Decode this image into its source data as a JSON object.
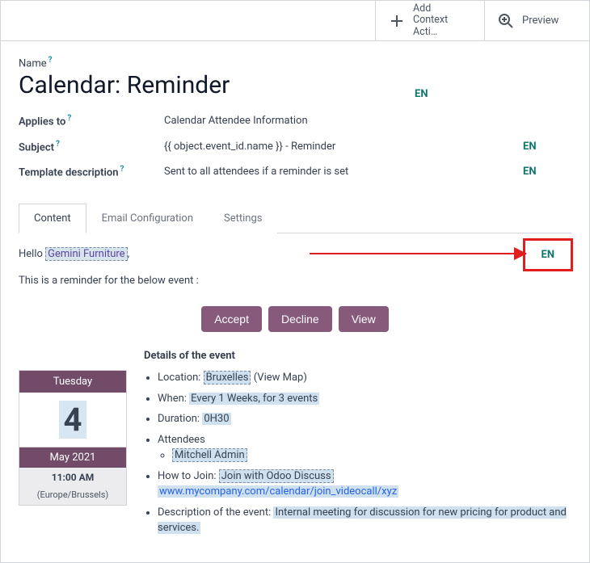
{
  "toolbar": {
    "add_line1": "Add",
    "add_line2": "Context Acti…",
    "preview": "Preview"
  },
  "name": {
    "label": "Name",
    "value": "Calendar: Reminder",
    "lang": "EN"
  },
  "fields": {
    "applies_to": {
      "label": "Applies to",
      "value": "Calendar Attendee Information",
      "lang": ""
    },
    "subject": {
      "label": "Subject",
      "value": "{{ object.event_id.name }} - Reminder",
      "lang": "EN"
    },
    "template_desc": {
      "label": "Template description",
      "value": "Sent to all attendees if a reminder is set",
      "lang": "EN"
    }
  },
  "tabs": {
    "content": "Content",
    "email_config": "Email Configuration",
    "settings": "Settings"
  },
  "body": {
    "hello_prefix": "Hello ",
    "hello_dyn": "Gemini Furniture",
    "hello_suffix": ",",
    "reminder_line": "This is a reminder for the below event :",
    "en_badge": "EN",
    "accept": "Accept",
    "decline": "Decline",
    "view": "View",
    "details_heading": "Details of the event",
    "cal": {
      "dow": "Tuesday",
      "day": "4",
      "month": "May 2021",
      "time": "11:00 AM",
      "tz": "(Europe/Brussels)"
    },
    "details": {
      "location_label": "Location: ",
      "location_val": "Bruxelles",
      "location_viewmap": " (View Map)",
      "when_label": "When: ",
      "when_val": "Every 1 Weeks, for 3 events",
      "duration_label": "Duration: ",
      "duration_val": "0H30",
      "attendees_label": "Attendees",
      "attendee1": "Mitchell Admin",
      "howto_label": "How to Join: ",
      "howto_val": "Join with Odoo Discuss",
      "howto_url": "www.mycompany.com/calendar/join_videocall/xyz",
      "desc_label": "Description of the event: ",
      "desc_val": "Internal meeting for discussion for new pricing for product and services."
    }
  }
}
